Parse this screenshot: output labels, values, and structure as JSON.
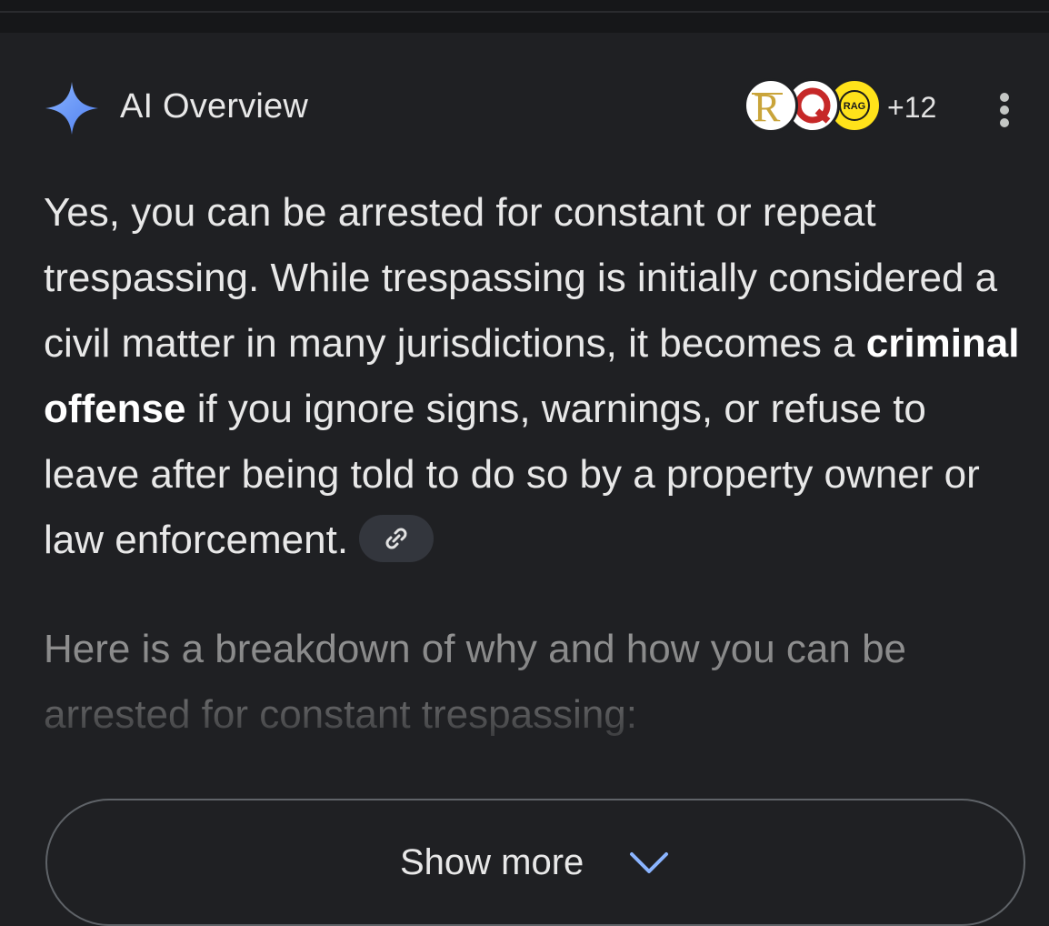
{
  "header": {
    "title": "AI Overview",
    "more_sources": "+12",
    "sparkle_color": "#6b8ef5"
  },
  "sources": [
    {
      "icon": "r-logo-icon",
      "text": "R"
    },
    {
      "icon": "q-logo-icon",
      "text": "Q"
    },
    {
      "icon": "rag-logo-icon",
      "text": "RAG"
    }
  ],
  "answer": {
    "part1": "Yes, you can be arrested for constant or repeat trespassing. While trespassing is initially considered a civil matter in many jurisdictions, it becomes a ",
    "bold": "criminal offense",
    "part2": " if you ignore signs, warnings, or refuse to leave after being told to do so by a property owner or law enforcement."
  },
  "breakdown": "Here is a breakdown of why and how you can be arrested for constant trespassing:",
  "show_more": {
    "label": "Show more"
  }
}
